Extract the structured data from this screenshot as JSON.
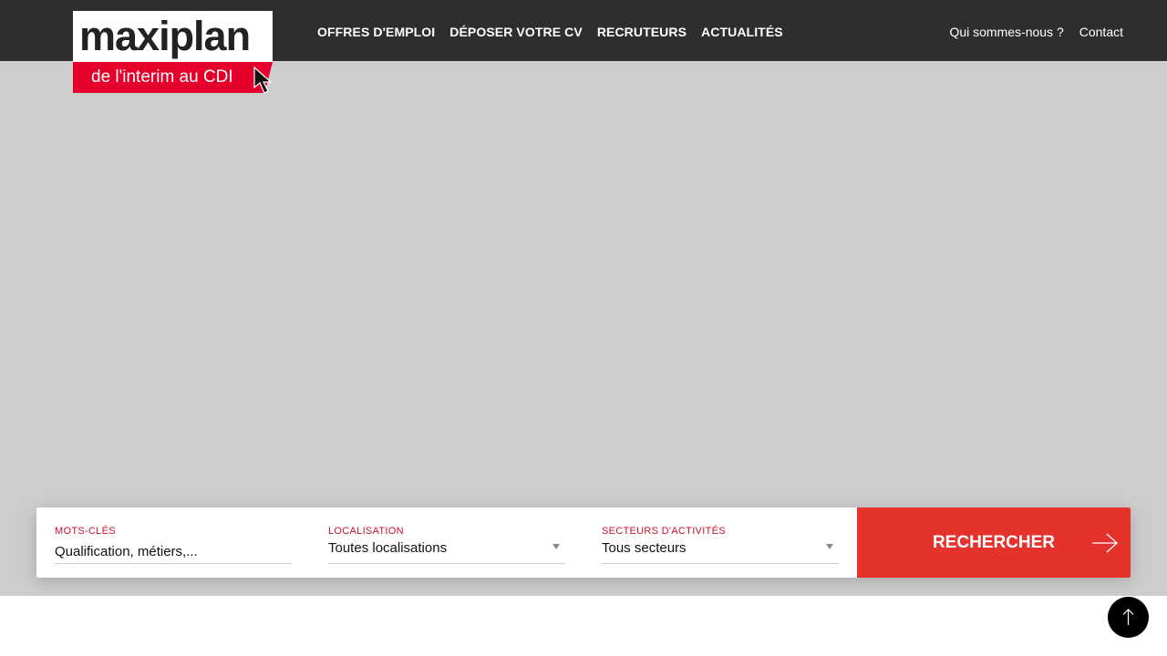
{
  "brand": {
    "name": "maxiplan",
    "tagline": "de l'interim au CDI",
    "accent_color": "#e4002b"
  },
  "nav": {
    "main": [
      {
        "label": "OFFRES D'EMPLOI"
      },
      {
        "label": "DÉPOSER VOTRE CV"
      },
      {
        "label": "RECRUTEURS"
      },
      {
        "label": "ACTUALITÉS"
      }
    ],
    "secondary": [
      {
        "label": "Qui sommes-nous ?"
      },
      {
        "label": "Contact"
      }
    ]
  },
  "search": {
    "keywords": {
      "label": "MOTS-CLÉS",
      "placeholder": "Qualification, métiers,..."
    },
    "location": {
      "label": "LOCALISATION",
      "selected": "Toutes localisations"
    },
    "sector": {
      "label": "SECTEURS D'ACTIVITÉS",
      "selected": "Tous secteurs"
    },
    "submit_label": "RECHERCHER",
    "button_color": "#e5322d"
  },
  "icons": {
    "search_arrow": "arrow-right-icon",
    "scroll_top": "arrow-up-icon",
    "logo_cursor": "mouse-cursor-icon",
    "dropdown": "caret-down-icon"
  }
}
